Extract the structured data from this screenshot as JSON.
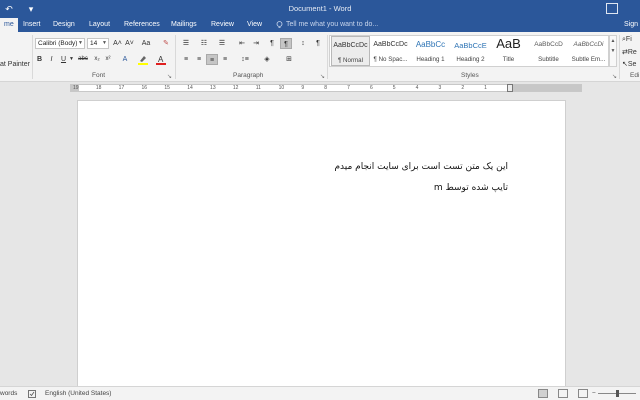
{
  "titlebar": {
    "title": "Document1 - Word"
  },
  "tabs": [
    {
      "label": "me"
    },
    {
      "label": "Insert"
    },
    {
      "label": "Design"
    },
    {
      "label": "Layout"
    },
    {
      "label": "References"
    },
    {
      "label": "Mailings"
    },
    {
      "label": "Review"
    },
    {
      "label": "View"
    }
  ],
  "tell_me": {
    "placeholder": "Tell me what you want to do..."
  },
  "signin": "Sign",
  "ribbon": {
    "clipboard": {
      "format_painter": "at Painter"
    },
    "font": {
      "label": "Font",
      "font_name": "Calibri (Body)",
      "font_size": "14",
      "grow": "A˄",
      "shrink": "A˅",
      "case": "Aa",
      "bold": "B",
      "italic": "I",
      "underline": "U",
      "strike": "abc",
      "subscript": "x₂",
      "superscript": "x²"
    },
    "paragraph": {
      "label": "Paragraph",
      "pilcrow": "¶"
    },
    "styles": {
      "label": "Styles",
      "items": [
        {
          "preview": "AaBbCcDc",
          "name": "¶ Normal"
        },
        {
          "preview": "AaBbCcDc",
          "name": "¶ No Spac..."
        },
        {
          "preview": "AaBbCc",
          "name": "Heading 1"
        },
        {
          "preview": "AaBbCcE",
          "name": "Heading 2"
        },
        {
          "preview": "AaB",
          "name": "Title"
        },
        {
          "preview": "AaBbCcD",
          "name": "Subtitle"
        },
        {
          "preview": "AaBbCcDi",
          "name": "Subtle Em..."
        }
      ]
    },
    "editing": {
      "find": "Fi",
      "replace": "Re",
      "select": "Se",
      "label": "Edi"
    }
  },
  "ruler": {
    "ticks": [
      "19",
      "18",
      "17",
      "16",
      "15",
      "14",
      "13",
      "12",
      "11",
      "10",
      "9",
      "8",
      "7",
      "6",
      "5",
      "4",
      "3",
      "2",
      "1"
    ]
  },
  "document": {
    "lines": [
      "این یک متن تست است برای سایت انجام میدم",
      "تایپ شده توسط m"
    ]
  },
  "statusbar": {
    "words": "words",
    "language": "English (United States)"
  },
  "colors": {
    "accent": "#2b579a",
    "ribbon_bg": "#f3f3f3",
    "canvas_bg": "#e6e6e6"
  }
}
